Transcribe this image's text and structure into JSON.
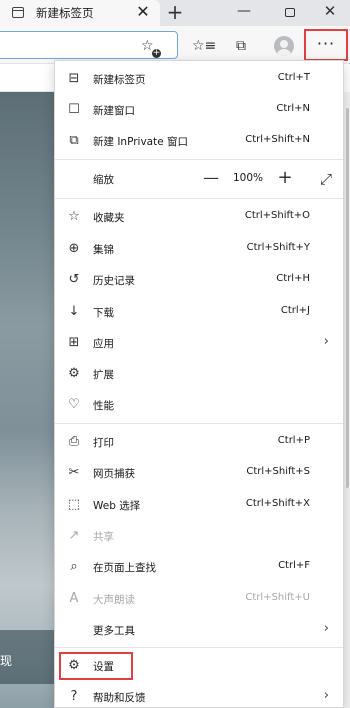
{
  "tab": {
    "title": "新建标签页",
    "close": "✕",
    "new_tab": "+"
  },
  "window": {
    "minimize": "—",
    "close": "✕"
  },
  "toolbar": {
    "favorites_icon": "favorites-star-icon",
    "collections_icon": "collections-icon",
    "profile_icon": "profile-avatar-icon",
    "more": "···"
  },
  "menu": {
    "new_tab": {
      "label": "新建标签页",
      "shortcut": "Ctrl+T"
    },
    "new_window": {
      "label": "新建窗口",
      "shortcut": "Ctrl+N"
    },
    "new_inprivate": {
      "label": "新建 InPrivate 窗口",
      "shortcut": "Ctrl+Shift+N"
    },
    "zoom": {
      "label": "缩放",
      "minus": "—",
      "value": "100%",
      "plus": "+"
    },
    "favorites": {
      "label": "收藏夹",
      "shortcut": "Ctrl+Shift+O"
    },
    "collections": {
      "label": "集锦",
      "shortcut": "Ctrl+Shift+Y"
    },
    "history": {
      "label": "历史记录",
      "shortcut": "Ctrl+H"
    },
    "downloads": {
      "label": "下载",
      "shortcut": "Ctrl+J"
    },
    "apps": {
      "label": "应用",
      "chevron": "›"
    },
    "extensions": {
      "label": "扩展"
    },
    "performance": {
      "label": "性能"
    },
    "print": {
      "label": "打印",
      "shortcut": "Ctrl+P"
    },
    "web_capture": {
      "label": "网页捕获",
      "shortcut": "Ctrl+Shift+S"
    },
    "web_select": {
      "label": "Web 选择",
      "shortcut": "Ctrl+Shift+X"
    },
    "share": {
      "label": "共享"
    },
    "find": {
      "label": "在页面上查找",
      "shortcut": "Ctrl+F"
    },
    "read_aloud": {
      "label": "大声朗读",
      "shortcut": "Ctrl+Shift+U"
    },
    "more_tools": {
      "label": "更多工具",
      "chevron": "›"
    },
    "settings": {
      "label": "设置"
    },
    "help": {
      "label": "帮助和反馈",
      "chevron": "›"
    }
  },
  "page": {
    "bottom_fragment": "现"
  },
  "colors": {
    "highlight_border": "#e04040",
    "address_border": "#6da6e4",
    "mic_blue": "#2f7bd6"
  }
}
